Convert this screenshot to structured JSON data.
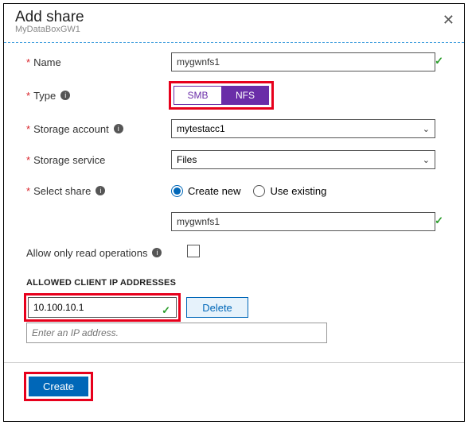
{
  "header": {
    "title": "Add share",
    "subtitle": "MyDataBoxGW1"
  },
  "fields": {
    "name": {
      "label": "Name",
      "value": "mygwnfs1"
    },
    "type": {
      "label": "Type",
      "smb": "SMB",
      "nfs": "NFS"
    },
    "storage_account": {
      "label": "Storage account",
      "value": "mytestacc1"
    },
    "storage_service": {
      "label": "Storage service",
      "value": "Files"
    },
    "select_share": {
      "label": "Select share",
      "create_new": "Create new",
      "use_existing": "Use existing",
      "share_name": "mygwnfs1"
    },
    "allow_read": {
      "label": "Allow only read operations"
    }
  },
  "ip_section": {
    "title": "ALLOWED CLIENT IP ADDRESSES",
    "ip1": "10.100.10.1",
    "delete_label": "Delete",
    "placeholder": "Enter an IP address."
  },
  "footer": {
    "create": "Create"
  }
}
